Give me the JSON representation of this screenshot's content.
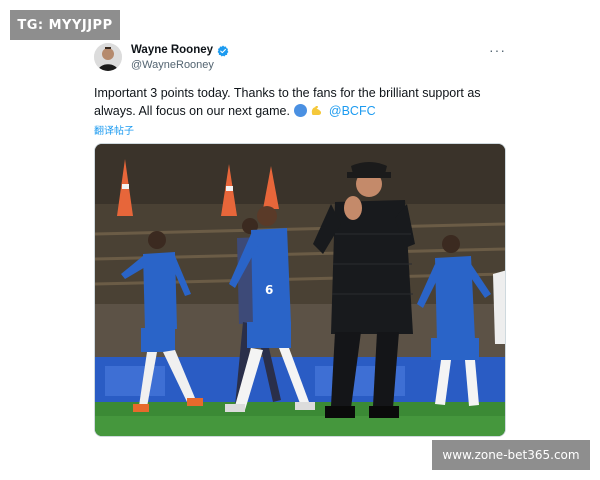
{
  "watermark_top_left": "TG: MYYJJPP",
  "watermark_bottom_right": "www.zone-bet365.com",
  "tweet": {
    "author": {
      "display_name": "Wayne Rooney",
      "handle": "@WayneRooney",
      "verified": true
    },
    "text_part1": "Important 3 points today. Thanks to the fans for the brilliant support as always. All focus on our next game.",
    "emojis": [
      "blue-circle-emoji",
      "flexed-biceps-emoji"
    ],
    "mention": "@BCFC",
    "translate_label": "翻译帖子",
    "more_icon": "ellipsis-icon",
    "media_alt": "",
    "colors": {
      "accent": "#1d9bf0",
      "kit_blue": "#2a64c8",
      "pitch_green": "#3b8a35",
      "text": "#0f1419",
      "muted": "#536471"
    }
  }
}
